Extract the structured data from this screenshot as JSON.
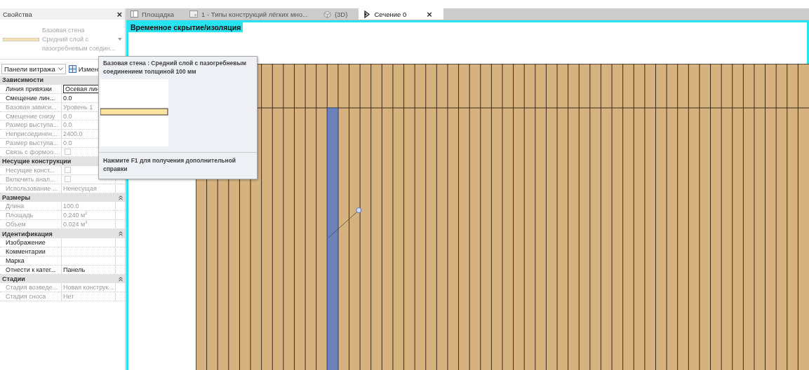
{
  "properties": {
    "title": "Свойства",
    "close": "×",
    "type_selector": [
      "Базовая стена",
      "Средний слой с",
      "пазогребневым соедин..."
    ],
    "filter": "Панели витража",
    "edit_type": "Измен",
    "groups": [
      {
        "name": "Зависимости",
        "rows": [
          {
            "label": "Линия привязки",
            "value": "Осевая лин",
            "kind": "field",
            "disabled": false
          },
          {
            "label": "Смещение лин...",
            "value": "0.0",
            "kind": "text",
            "disabled": false
          },
          {
            "label": "Базовая зависи...",
            "value": "Уровень 1",
            "kind": "text",
            "disabled": true
          },
          {
            "label": "Смещение снизу",
            "value": "0.0",
            "kind": "text",
            "disabled": true
          },
          {
            "label": "Размер выступа...",
            "value": "0.0",
            "kind": "text",
            "disabled": true
          },
          {
            "label": "Неприсоединен...",
            "value": "2400.0",
            "kind": "text",
            "disabled": true
          },
          {
            "label": "Размер выступа...",
            "value": "0.0",
            "kind": "text",
            "disabled": true
          },
          {
            "label": "Связь с формоо...",
            "checked": false,
            "kind": "checkbox",
            "disabled": true
          }
        ]
      },
      {
        "name": "Несущие конструкции",
        "rows": [
          {
            "label": "Несущие конст...",
            "checked": false,
            "kind": "checkbox",
            "disabled": true
          },
          {
            "label": "Включить анал...",
            "checked": false,
            "kind": "checkbox",
            "disabled": true
          },
          {
            "label": "Использование ...",
            "value": "Ненесущая",
            "kind": "text",
            "disabled": true
          }
        ]
      },
      {
        "name": "Размеры",
        "expanded": true,
        "rows": [
          {
            "label": "Длина",
            "value": "100.0",
            "kind": "text",
            "disabled": true
          },
          {
            "label": "Площадь",
            "value": "0.240 м$^{2}$",
            "kind": "text",
            "disabled": true
          },
          {
            "label": "Объем",
            "value": "0.024 м$^{3}$",
            "kind": "text",
            "disabled": true
          }
        ]
      },
      {
        "name": "Идентификация",
        "expanded": true,
        "rows": [
          {
            "label": "Изображение",
            "kind": "text",
            "disabled": false
          },
          {
            "label": "Комментарии",
            "kind": "text",
            "disabled": false
          },
          {
            "label": "Марка",
            "kind": "text",
            "disabled": false
          },
          {
            "label": "Отнести к катег...",
            "value": "Панель",
            "kind": "text",
            "disabled": false
          }
        ]
      },
      {
        "name": "Стадии",
        "expanded": true,
        "rows": [
          {
            "label": "Стадия возведе...",
            "value": "Новая конструк...",
            "kind": "text",
            "disabled": true
          },
          {
            "label": "Стадия сноса",
            "value": "Нет",
            "kind": "text",
            "disabled": true
          }
        ]
      }
    ]
  },
  "tabs": [
    {
      "label": "Площадка",
      "kind": "plan",
      "selected": false
    },
    {
      "label": "1 - Типы конструкций лёгких мно...",
      "kind": "sheet",
      "selected": false
    },
    {
      "label": "(3D)",
      "kind": "model",
      "selected": false
    },
    {
      "label": "Сечение 0",
      "kind": "section",
      "selected": true,
      "close": "×"
    }
  ],
  "view": {
    "mode_banner": "Временное скрытие/изоляция"
  },
  "tooltip": {
    "title": "Базовая стена : Средний слой с пазогребневым соединением толщиной 100 мм",
    "help": "Нажмите F1 для получения дополнительной справки"
  }
}
